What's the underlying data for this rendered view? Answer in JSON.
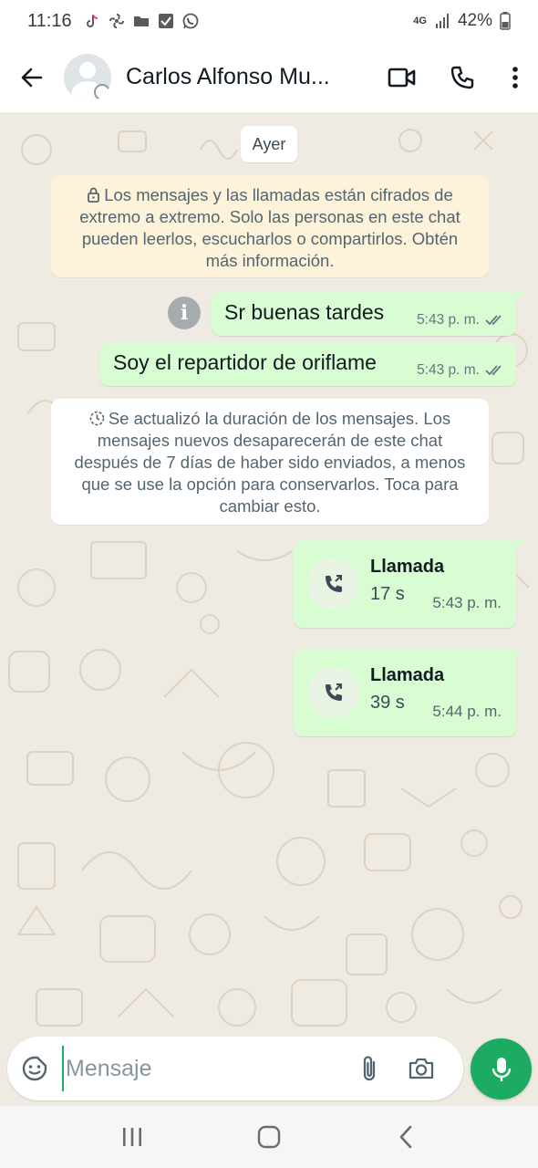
{
  "status_bar": {
    "time": "11:16",
    "network": "4G",
    "battery": "42%",
    "icons": [
      "tiktok-icon",
      "fan-icon",
      "folder-icon",
      "checkbox-icon",
      "whatsapp-icon",
      "signal-icon",
      "battery-icon"
    ]
  },
  "header": {
    "contact_name": "Carlos Alfonso Mu...",
    "actions": [
      "video-call-icon",
      "voice-call-icon",
      "more-vert-icon"
    ]
  },
  "chat": {
    "date_chip": "Ayer",
    "encryption_notice": "Los mensajes y las llamadas están cifrados de extremo a extremo. Solo las personas en este chat pueden leerlos, escucharlos o compartirlos. Obtén más información.",
    "messages": [
      {
        "text": "Sr buenas tardes",
        "time": "5:43 p. m.",
        "status": "read"
      },
      {
        "text": "Soy el repartidor de oriflame",
        "time": "5:43 p. m.",
        "status": "read"
      }
    ],
    "disappearing_notice": "Se actualizó la duración de los mensajes. Los mensajes nuevos desaparecerán de este chat después de 7 días de haber sido enviados, a menos que se use la opción para conservarlos. Toca para cambiar esto.",
    "calls": [
      {
        "title": "Llamada",
        "duration": "17 s",
        "time": "5:43 p. m."
      },
      {
        "title": "Llamada",
        "duration": "39 s",
        "time": "5:44 p. m."
      }
    ]
  },
  "composer": {
    "placeholder": "Mensaje"
  },
  "colors": {
    "accent": "#1daa61",
    "outgoing_bubble": "#d9fdd3",
    "chat_background": "#efeae2",
    "notice_background": "#fdf3da"
  }
}
